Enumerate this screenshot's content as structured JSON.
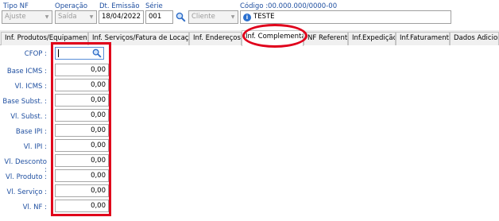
{
  "header": {
    "tipo_nf": {
      "label": "Tipo NF",
      "value": "Ajuste"
    },
    "operacao": {
      "label": "Operação",
      "value": "Saída"
    },
    "dt_emissao": {
      "label": "Dt. Emissão",
      "value": "18/04/2022"
    },
    "serie": {
      "label": "Série",
      "value": "001"
    },
    "destinatario_tipo": {
      "value": "Cliente"
    },
    "codigo": {
      "label": "Código :00.000.000/0000-00",
      "value": "TESTE"
    }
  },
  "tabs": [
    {
      "label": "Inf. Produtos/Equipamentos"
    },
    {
      "label": "Inf. Serviços/Fatura de Locação"
    },
    {
      "label": "Inf. Endereços"
    },
    {
      "label": "Inf. Complementar"
    },
    {
      "label": "NF Referente"
    },
    {
      "label": "Inf.Expedição"
    },
    {
      "label": "Inf.Faturamento"
    },
    {
      "label": "Dados Adiciona"
    }
  ],
  "active_tab": "Inf. Complementar",
  "form": {
    "cfop": {
      "label": "CFOP :",
      "value": ""
    },
    "fields": [
      {
        "label": "Base ICMS :",
        "value": "0,00"
      },
      {
        "label": "Vl. ICMS :",
        "value": "0,00"
      },
      {
        "label": "Base Subst. :",
        "value": "0,00"
      },
      {
        "label": "Vl. Subst. :",
        "value": "0,00"
      },
      {
        "label": "Base IPI :",
        "value": "0,00"
      },
      {
        "label": "Vl. IPI :",
        "value": "0,00"
      },
      {
        "label": "Vl. Desconto :",
        "value": "0,00"
      },
      {
        "label": "Vl. Produto :",
        "value": "0,00"
      },
      {
        "label": "Vl. Serviço :",
        "value": "0,00"
      },
      {
        "label": "Vl. NF :",
        "value": "0,00"
      }
    ]
  },
  "colors": {
    "label_blue": "#1f4fa0",
    "highlight_red": "#e0001b",
    "focus_border": "#5a8fd8"
  },
  "icons": {
    "lookup": "magnifier-icon",
    "info": "info-icon",
    "dropdown": "chevron-down-icon"
  }
}
